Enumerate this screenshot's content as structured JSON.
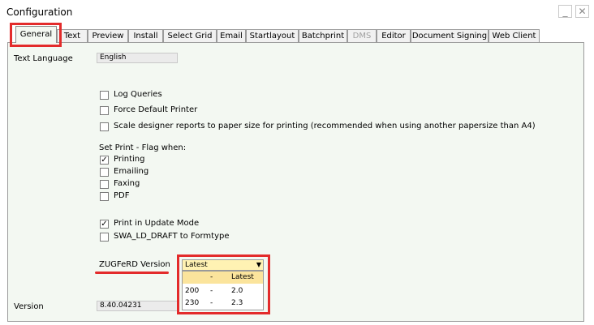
{
  "window": {
    "title": "Configuration",
    "minimize_glyph": "_",
    "close_glyph": "✕"
  },
  "tabs": [
    {
      "label": "General",
      "active": true
    },
    {
      "label": "Text"
    },
    {
      "label": "Preview"
    },
    {
      "label": "Install"
    },
    {
      "label": "Select Grid"
    },
    {
      "label": "Email"
    },
    {
      "label": "Startlayout"
    },
    {
      "label": "Batchprint"
    },
    {
      "label": "DMS",
      "disabled": true
    },
    {
      "label": "Editor"
    },
    {
      "label": "Document Signing"
    },
    {
      "label": "Web Client"
    }
  ],
  "general": {
    "text_language_label": "Text Language",
    "text_language_value": "English",
    "options": [
      {
        "label": "Log Queries",
        "checked": false
      },
      {
        "label": "Force Default Printer",
        "checked": false
      },
      {
        "label": "Scale designer reports to paper size for printing (recommended when using another papersize than A4)",
        "checked": false
      }
    ],
    "set_print_flag_label": "Set Print - Flag when:",
    "print_flags": [
      {
        "label": "Printing",
        "checked": true
      },
      {
        "label": "Emailing",
        "checked": false
      },
      {
        "label": "Faxing",
        "checked": false
      },
      {
        "label": "PDF",
        "checked": false
      }
    ],
    "update_options": [
      {
        "label": "Print in Update Mode",
        "checked": true
      },
      {
        "label": "SWA_LD_DRAFT to Formtype",
        "checked": false
      }
    ],
    "zugferd_label": "ZUGFeRD Version",
    "zugferd_selected": "Latest",
    "zugferd_options": [
      {
        "code": "",
        "sep": "-",
        "name": "Latest"
      },
      {
        "code": "200",
        "sep": "-",
        "name": "2.0"
      },
      {
        "code": "230",
        "sep": "-",
        "name": "2.3"
      }
    ],
    "version_label": "Version",
    "version_value": "8.40.04231"
  },
  "colors": {
    "highlight": "#e32b2b",
    "panel_bg": "#f3f8f2",
    "combo_bg": "#fff2b3",
    "dropdown_header_bg": "#fbe49c"
  }
}
